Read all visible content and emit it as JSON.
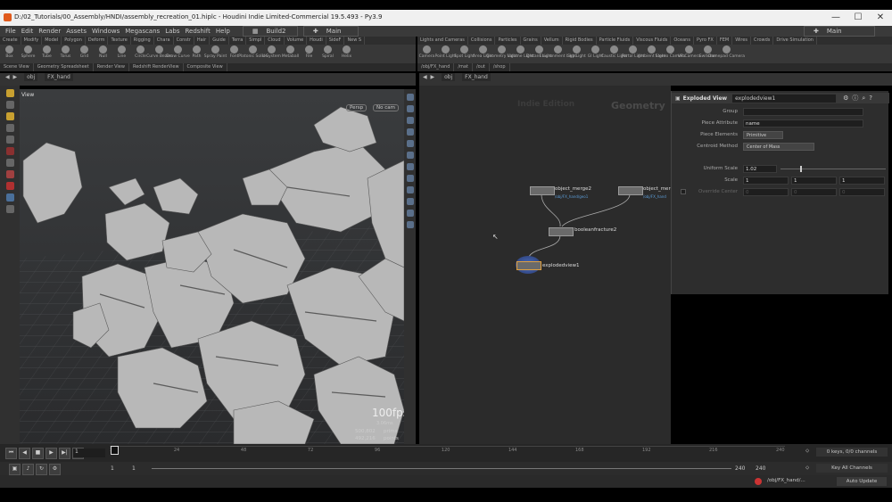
{
  "window": {
    "title": "D:/02_Tutorials/00_Assembly/HNDI/assembly_recreation_01.hiplc - Houdini Indie Limited-Commercial 19.5.493 - Py3.9",
    "minimize": "—",
    "maximize": "☐",
    "close": "✕"
  },
  "menu": {
    "items": [
      "File",
      "Edit",
      "Render",
      "Assets",
      "Windows",
      "Megascans",
      "Labs",
      "Redshift",
      "Help"
    ],
    "desktop": "Build2",
    "runtime": "Main",
    "right_desktop": "Main"
  },
  "shelf_tabs_left": [
    "Create",
    "Modify",
    "Model",
    "Polygon",
    "Deform",
    "Texture",
    "Rigging",
    "Chara",
    "Constr",
    "Hair",
    "Guide",
    "Terra",
    "Simpl",
    "Cloud",
    "Volume",
    "Houdi",
    "SideF",
    "New S"
  ],
  "shelf_tools_left": [
    "Box",
    "Sphere",
    "Tube",
    "Torus",
    "Grid",
    "Null",
    "Line",
    "Circle",
    "Curve Bezier",
    "Draw Curve",
    "Path",
    "Spray Paint",
    "Font",
    "Platonic Solids",
    "L-System",
    "Metaball",
    "File",
    "Spiral",
    "Helix"
  ],
  "shelf_tabs_right": [
    "Lights and Cameras",
    "Collisions",
    "Particles",
    "Grains",
    "Vellum",
    "Rigid Bodies",
    "Particle Fluids",
    "Viscous Fluids",
    "Oceans",
    "Pyro FX",
    "FEM",
    "Wires",
    "Crowds",
    "Drive Simulation"
  ],
  "shelf_tools_right": [
    "Camera",
    "Point Light",
    "Spot Light",
    "Area Light",
    "Geometry Light",
    "Volume Light",
    "Distant Light",
    "Environment Light",
    "Sky Light",
    "GI Light",
    "Caustic Light",
    "Portal Light",
    "Ambient Light",
    "Stereo Camera",
    "VR Camera",
    "Switcher",
    "Gamepad Camera"
  ],
  "pane_tabs_left": [
    "Scene View",
    "Geometry Spreadsheet",
    "Render View",
    "Redshift RenderView",
    "Composite View"
  ],
  "pane_tabs_right": [
    "/obj/FX_hand",
    "/mat",
    "/out",
    "/shop"
  ],
  "path_left": {
    "context": "obj",
    "node": "FX_hand"
  },
  "path_right": {
    "context": "obj",
    "node": "FX_hand"
  },
  "viewport": {
    "label": "View",
    "persp": "Persp",
    "cam": "No cam",
    "fps": "100fps",
    "time": "3.06ms",
    "prims": "500,802",
    "prims_label": "prims",
    "points": "492,216",
    "points_label": "points"
  },
  "network": {
    "watermark_left": "Indie Edition",
    "watermark_right": "Geometry",
    "nodes": [
      {
        "name": "object_merge2",
        "path": "/obj/FX_hand/geo1"
      },
      {
        "name": "object_merge",
        "path": "/obj/FX_hand"
      },
      {
        "name": "booleanfracture2",
        "path": ""
      },
      {
        "name": "explodedview1",
        "path": ""
      }
    ]
  },
  "params": {
    "node_type": "Exploded View",
    "node_name": "explodedview1",
    "fields": [
      {
        "label": "Group",
        "value": ""
      },
      {
        "label": "Piece Attribute",
        "value": "name"
      },
      {
        "label": "Piece Elements",
        "value": "Primitive"
      },
      {
        "label": "Centroid Method",
        "value": "Center of Mass"
      },
      {
        "label": "Uniform Scale",
        "value": "1.02"
      },
      {
        "label": "Scale",
        "values": [
          "1",
          "1",
          "1"
        ]
      },
      {
        "label": "Override Center",
        "values": [
          "0",
          "0",
          "0"
        ]
      }
    ]
  },
  "timeline": {
    "ticks": [
      "1",
      "24",
      "48",
      "72",
      "96",
      "120",
      "144",
      "168",
      "192",
      "216",
      "240"
    ],
    "current_frame": "1",
    "start": "1",
    "start2": "1",
    "end": "240",
    "end2": "240"
  },
  "keys": {
    "channels": "0 keys, 0/0 channels",
    "key_all": "Key All Channels"
  },
  "status": {
    "path": "/obj/FX_hand/...",
    "update": "Auto Update"
  }
}
